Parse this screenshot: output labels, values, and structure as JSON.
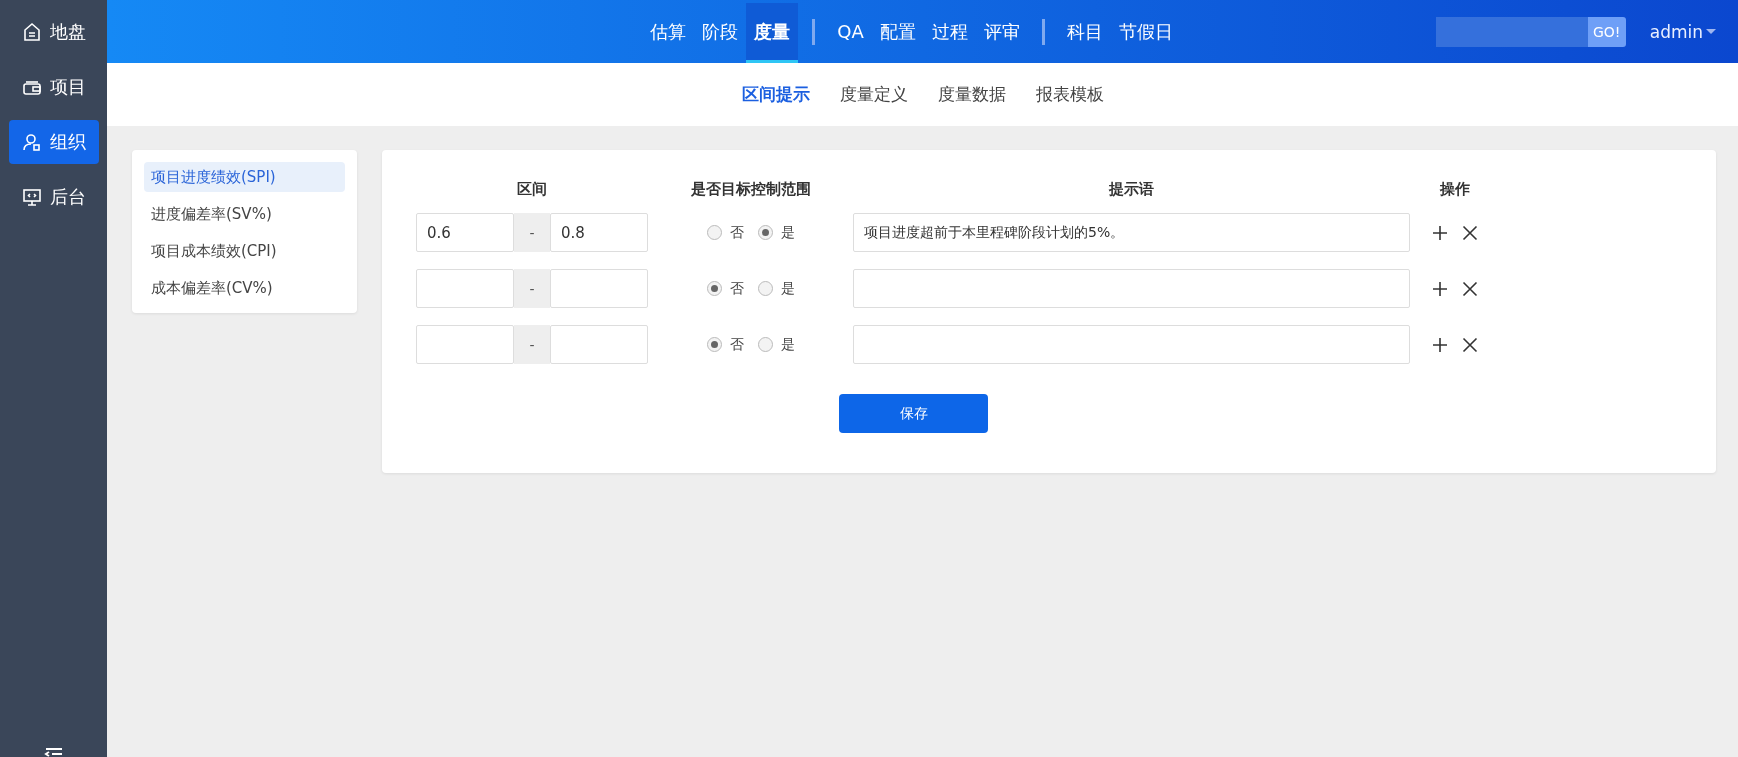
{
  "sidebar": {
    "items": [
      {
        "kind": "home",
        "label": "地盘",
        "selected": false
      },
      {
        "kind": "wallet",
        "label": "项目",
        "selected": false
      },
      {
        "kind": "user",
        "label": "组织",
        "selected": true
      },
      {
        "kind": "monitor",
        "label": "后台",
        "selected": false
      }
    ]
  },
  "top_nav": {
    "groups": [
      [
        {
          "label": "估算",
          "selected": false
        },
        {
          "label": "阶段",
          "selected": false
        },
        {
          "label": "度量",
          "selected": true
        }
      ],
      [
        {
          "label": "QA",
          "selected": false
        },
        {
          "label": "配置",
          "selected": false
        },
        {
          "label": "过程",
          "selected": false
        },
        {
          "label": "评审",
          "selected": false
        }
      ],
      [
        {
          "label": "科目",
          "selected": false
        },
        {
          "label": "节假日",
          "selected": false
        }
      ]
    ]
  },
  "search": {
    "button": "GO!"
  },
  "user": {
    "name": "admin"
  },
  "sub_tabs": [
    {
      "label": "区间提示",
      "selected": true
    },
    {
      "label": "度量定义",
      "selected": false
    },
    {
      "label": "度量数据",
      "selected": false
    },
    {
      "label": "报表模板",
      "selected": false
    }
  ],
  "metrics": [
    {
      "label": "项目进度绩效(SPI)",
      "selected": true
    },
    {
      "label": "进度偏差率(SV%)",
      "selected": false
    },
    {
      "label": "项目成本绩效(CPI)",
      "selected": false
    },
    {
      "label": "成本偏差率(CV%)",
      "selected": false
    }
  ],
  "table": {
    "columns": [
      "区间",
      "是否目标控制范围",
      "提示语",
      "操作"
    ],
    "rows": [
      {
        "low": "0.6",
        "separator": "-",
        "high": "0.8",
        "options": [
          {
            "label": "否",
            "selected": false
          },
          {
            "label": "是",
            "selected": true
          }
        ],
        "hint": "项目进度超前于本里程碑阶段计划的5%。"
      },
      {
        "separator": "-",
        "options": [
          {
            "label": "否",
            "selected": true
          },
          {
            "label": "是",
            "selected": false
          }
        ]
      },
      {
        "separator": "-",
        "options": [
          {
            "label": "否",
            "selected": true
          },
          {
            "label": "是",
            "selected": false
          }
        ]
      }
    ]
  },
  "save_button": "保存"
}
